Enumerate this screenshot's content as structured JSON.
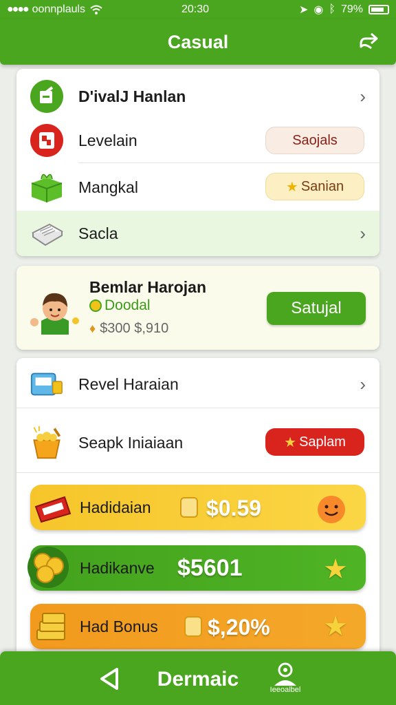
{
  "status_bar": {
    "carrier": "oonnplauls",
    "time": "20:30",
    "battery": "79%"
  },
  "app_bar": {
    "title": "Casual"
  },
  "menu_card": {
    "items": [
      {
        "label": "D'ivalJ Hanlan"
      },
      {
        "label": "Levelain",
        "badge": "Saojals"
      },
      {
        "label": "Mangkal",
        "badge": "Sanian"
      },
      {
        "label": "Sacla"
      }
    ]
  },
  "profile": {
    "name": "Bemlar Harojan",
    "tag": "Doodal",
    "balance": "$300 $,910",
    "button": "Satujal"
  },
  "lower_card": {
    "items": [
      {
        "label": "Revel Haraian"
      },
      {
        "label": "Seapk Iniaiaan",
        "badge": "Saplam"
      }
    ]
  },
  "promos": [
    {
      "label": "Hadidaian",
      "amount": "$0.59"
    },
    {
      "label": "Hadikanve",
      "amount": "$5601"
    },
    {
      "label": "Had Bonus",
      "amount": "$,20%"
    }
  ],
  "bottom_bar": {
    "title": "Dermaic",
    "profile_caption": "Ieeoalbel"
  },
  "colors": {
    "brand_green": "#4aa51f",
    "badge_red": "#d9231d",
    "promo_yellow": "#f6c52a",
    "promo_orange": "#f29a1d"
  }
}
